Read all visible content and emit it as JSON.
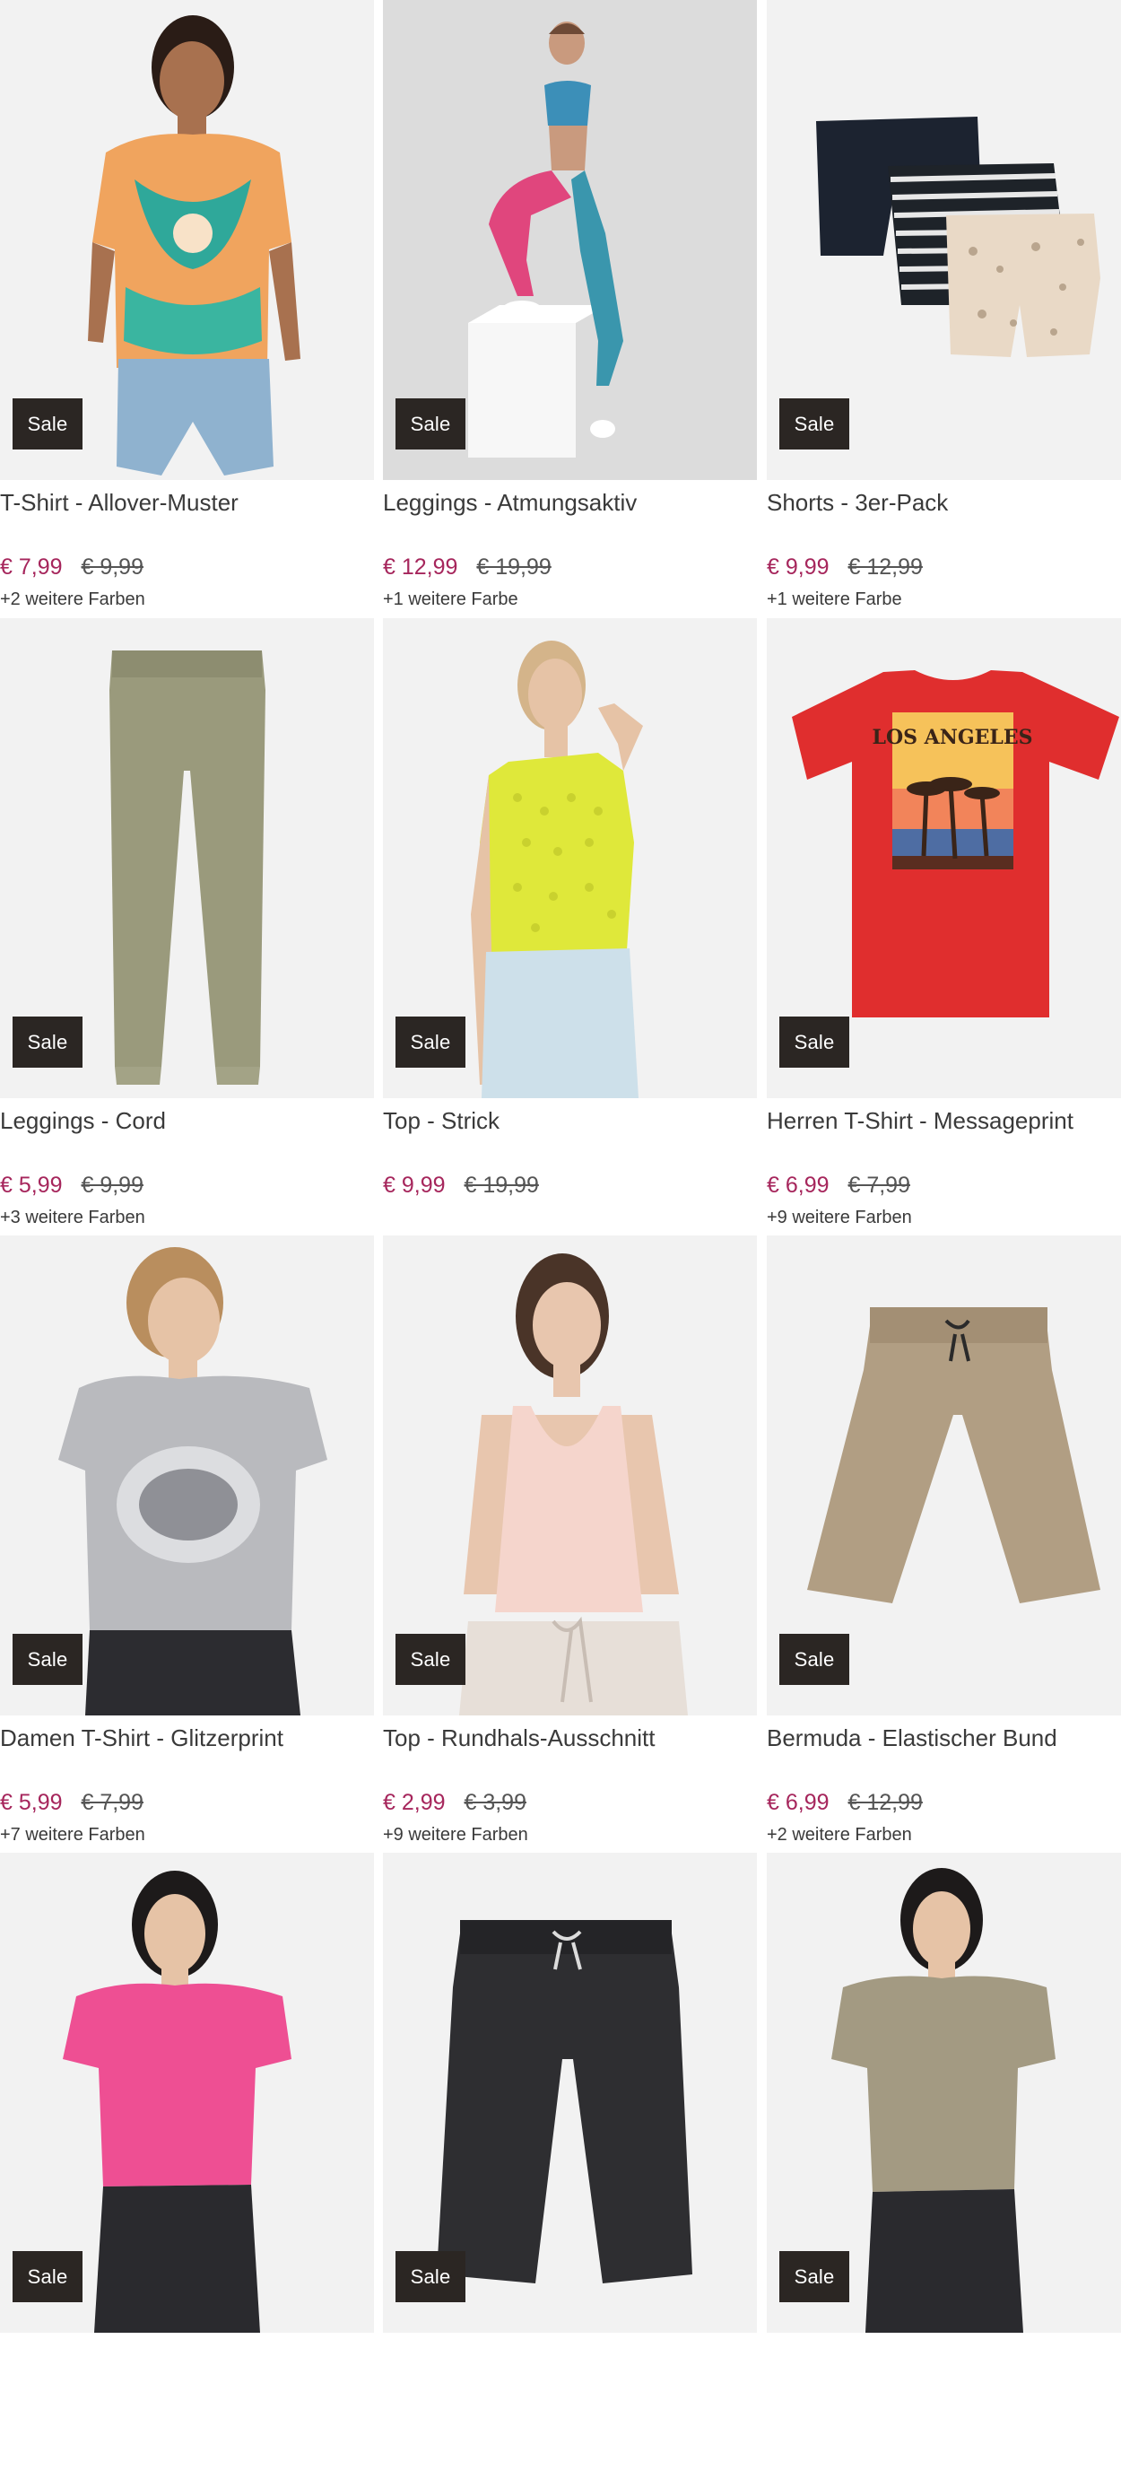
{
  "products": [
    {
      "title": "T-Shirt - Allover-Muster",
      "price_now": "€ 7,99",
      "price_old": "€ 9,99",
      "colors": "+2 weitere Farben",
      "badge": "Sale",
      "image_icon": "patterned-tshirt-model-image"
    },
    {
      "title": "Leggings - Atmungsaktiv",
      "price_now": "€ 12,99",
      "price_old": "€ 19,99",
      "colors": "+1 weitere Farbe",
      "badge": "Sale",
      "image_icon": "leggings-model-image"
    },
    {
      "title": "Shorts - 3er-Pack",
      "price_now": "€ 9,99",
      "price_old": "€ 12,99",
      "colors": "+1 weitere Farbe",
      "badge": "Sale",
      "image_icon": "shorts-pack-image"
    },
    {
      "title": "Leggings - Cord",
      "price_now": "€ 5,99",
      "price_old": "€ 9,99",
      "colors": "+3 weitere Farben",
      "badge": "Sale",
      "image_icon": "cord-leggings-image"
    },
    {
      "title": "Top - Strick",
      "price_now": "€ 9,99",
      "price_old": "€ 19,99",
      "colors": "",
      "badge": "Sale",
      "image_icon": "knit-top-model-image"
    },
    {
      "title": "Herren T-Shirt - Messageprint",
      "price_now": "€ 6,99",
      "price_old": "€ 7,99",
      "colors": "+9 weitere Farben",
      "badge": "Sale",
      "image_icon": "red-print-tshirt-image"
    },
    {
      "title": "Damen T-Shirt - Glitzerprint",
      "price_now": "€ 5,99",
      "price_old": "€ 7,99",
      "colors": "+7 weitere Farben",
      "badge": "Sale",
      "image_icon": "glitter-tshirt-model-image"
    },
    {
      "title": "Top - Rundhals-Ausschnitt",
      "price_now": "€ 2,99",
      "price_old": "€ 3,99",
      "colors": "+9 weitere Farben",
      "badge": "Sale",
      "image_icon": "tank-top-model-image"
    },
    {
      "title": "Bermuda - Elastischer Bund",
      "price_now": "€ 6,99",
      "price_old": "€ 12,99",
      "colors": "+2 weitere Farben",
      "badge": "Sale",
      "image_icon": "bermuda-shorts-image"
    },
    {
      "title": "",
      "price_now": "",
      "price_old": "",
      "colors": "",
      "badge": "Sale",
      "image_icon": "pink-tshirt-model-image"
    },
    {
      "title": "",
      "price_now": "",
      "price_old": "",
      "colors": "",
      "badge": "Sale",
      "image_icon": "black-bermuda-image"
    },
    {
      "title": "",
      "price_now": "",
      "price_old": "",
      "colors": "",
      "badge": "Sale",
      "image_icon": "olive-tshirt-model-image"
    }
  ],
  "colors": {
    "sale_badge_bg": "#2b2623",
    "price_now": "#a6265c",
    "text": "#3a3a3a",
    "image_bg": "#f2f2f2"
  }
}
